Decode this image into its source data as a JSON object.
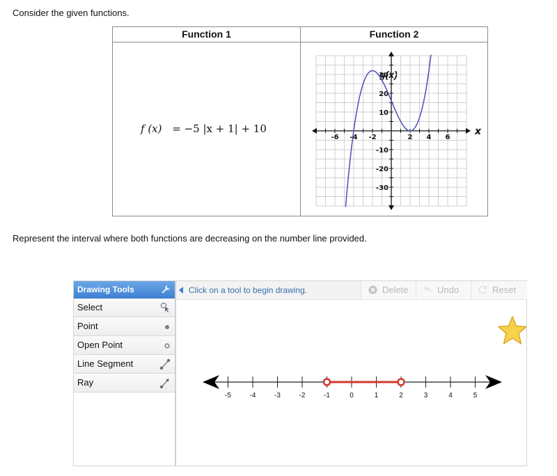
{
  "prompt_top": "Consider the given functions.",
  "table": {
    "col1_header": "Function 1",
    "col2_header": "Function 2",
    "function1": {
      "lhs": "f (x)",
      "rhs": "= −5 |x + 1| + 10"
    },
    "function2": {
      "graph_label": "g(x)",
      "x_axis_label": "x",
      "x_ticks": [
        "-6",
        "-4",
        "-2",
        "2",
        "4",
        "6"
      ],
      "y_ticks": [
        "30",
        "20",
        "10",
        "-10",
        "-20",
        "-30"
      ],
      "curve_color": "#4a4fb8"
    }
  },
  "prompt_bottom": "Represent the interval where both functions are decreasing on the number line provided.",
  "widget": {
    "sidebar_title": "Drawing Tools",
    "tools": [
      {
        "label": "Select",
        "icon": "select-cursor-icon"
      },
      {
        "label": "Point",
        "icon": "closed-point-icon"
      },
      {
        "label": "Open Point",
        "icon": "open-point-icon"
      },
      {
        "label": "Line Segment",
        "icon": "line-segment-icon"
      },
      {
        "label": "Ray",
        "icon": "ray-icon"
      }
    ],
    "hint": "Click on a tool to begin drawing.",
    "buttons": {
      "delete": "Delete",
      "undo": "Undo",
      "reset": "Reset"
    },
    "number_line": {
      "ticks": [
        "-5",
        "-4",
        "-3",
        "-2",
        "-1",
        "0",
        "1",
        "2",
        "3",
        "4",
        "5"
      ],
      "segment": {
        "from": -1,
        "to": 2,
        "from_open": true,
        "to_open": true
      },
      "segment_color": "#d0372c"
    },
    "accent_color": "#3d7fd3",
    "star_color": "#f7d24a"
  }
}
